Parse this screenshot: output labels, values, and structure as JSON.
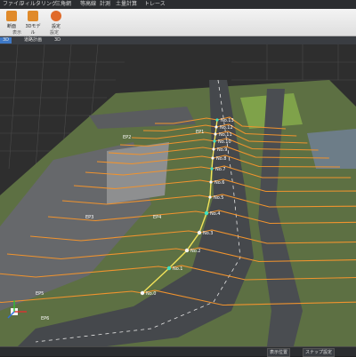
{
  "menu": [
    "ファイル",
    "フィルタリング",
    "三角網",
    "等高線",
    "計測",
    "土量計算",
    "トレース"
  ],
  "ribbon": {
    "buttons": [
      {
        "label": "断面",
        "color": "#e08a2a"
      },
      {
        "label": "3Dモデル",
        "color": "#e08a2a"
      },
      {
        "label": "設定",
        "color": "#e06a2a"
      }
    ],
    "group_labels": [
      "表示",
      "設定"
    ]
  },
  "tabs": [
    "3D",
    "道路計画",
    "3D"
  ],
  "points": [
    {
      "label": "No.13"
    },
    {
      "label": "No.12"
    },
    {
      "label": "No.11"
    },
    {
      "label": "No.10"
    },
    {
      "label": "No.9"
    },
    {
      "label": "No.8"
    },
    {
      "label": "No.7"
    },
    {
      "label": "No.6"
    },
    {
      "label": "No.5"
    },
    {
      "label": "No.4"
    },
    {
      "label": "No.3"
    },
    {
      "label": "No.2"
    },
    {
      "label": "No.1"
    },
    {
      "label": "No.0"
    }
  ],
  "side_labels": [
    "EP1",
    "EP2",
    "EP3",
    "EP4",
    "EP5",
    "EP6"
  ],
  "status": {
    "btn1": "表示位置",
    "btn2": "スナップ設定"
  },
  "colors": {
    "section_lines": "#f0932e",
    "centerline": "#f2e35a",
    "grass": "#5f8a3a",
    "asphalt": "#4b4e52"
  }
}
